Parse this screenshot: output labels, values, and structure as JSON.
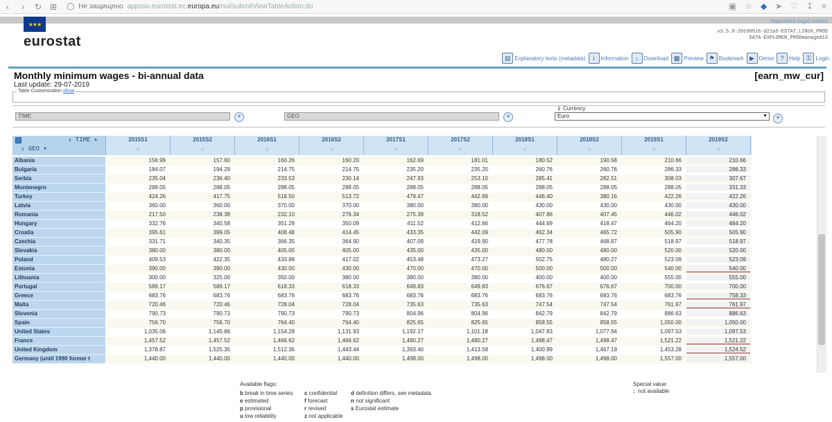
{
  "browser": {
    "security_label": "Не защищено",
    "url_prefix": "appsso.eurostat.ec.",
    "url_domain": "europa.eu",
    "url_path": "/nui/submitViewTableAction.do"
  },
  "header": {
    "legal_notice": "Important legal notice",
    "logo_text": "eurostat",
    "version_line1": "v3.5.0-20190516-d21a5-ESTAT_LINUX_PROD",
    "version_line2": "DATA-EXPLORER_PRODmanaged13",
    "toolbar": [
      {
        "label": "Explanatory texts (metadata)",
        "icon": "metadata-icon"
      },
      {
        "label": "Information",
        "icon": "info-icon"
      },
      {
        "label": "Download",
        "icon": "download-icon"
      },
      {
        "label": "Preview",
        "icon": "preview-icon"
      },
      {
        "label": "Bookmark",
        "icon": "bookmark-icon"
      },
      {
        "label": "Demo",
        "icon": "demo-icon"
      },
      {
        "label": "Help",
        "icon": "help-icon"
      },
      {
        "label": "Login",
        "icon": "login-icon"
      }
    ]
  },
  "page": {
    "title": "Monthly minimum wages - bi-annual data",
    "code": "[earn_mw_cur]",
    "last_update": "Last update: 29-07-2019"
  },
  "customization": {
    "legend": "Table Customization",
    "show_link": "show",
    "time_box": "TIME",
    "geo_box": "GEO",
    "currency_label": "Currency",
    "currency_value": "Euro"
  },
  "table": {
    "time_label": "TIME",
    "geo_label": "GEO",
    "columns": [
      "2015S1",
      "2015S2",
      "2016S1",
      "2016S2",
      "2017S1",
      "2017S2",
      "2018S1",
      "2018S2",
      "2019S1",
      "2019S2"
    ],
    "rows": [
      {
        "geo": "Albania",
        "values": [
          "156.99",
          "157.60",
          "160.26",
          "160.20",
          "162.69",
          "181.01",
          "180.52",
          "190.58",
          "210.66",
          "210.66"
        ]
      },
      {
        "geo": "Bulgaria",
        "values": [
          "184.07",
          "194.29",
          "214.75",
          "214.75",
          "235.20",
          "235.20",
          "260.76",
          "260.76",
          "286.33",
          "286.33"
        ]
      },
      {
        "geo": "Serbia",
        "values": [
          "235.04",
          "236.40",
          "233.53",
          "230.14",
          "247.93",
          "253.10",
          "285.41",
          "282.51",
          "308.03",
          "307.67"
        ]
      },
      {
        "geo": "Montenegro",
        "values": [
          "288.05",
          "288.05",
          "288.05",
          "288.05",
          "288.05",
          "288.05",
          "288.05",
          "288.05",
          "288.05",
          "331.33"
        ]
      },
      {
        "geo": "Turkey",
        "values": [
          "424.26",
          "417.75",
          "518.50",
          "513.72",
          "479.47",
          "442.89",
          "446.40",
          "380.16",
          "422.26",
          "422.26"
        ]
      },
      {
        "geo": "Latvia",
        "values": [
          "360.00",
          "360.00",
          "370.00",
          "370.00",
          "380.00",
          "380.00",
          "430.00",
          "430.00",
          "430.00",
          "430.00"
        ]
      },
      {
        "geo": "Romania",
        "values": [
          "217.50",
          "238.38",
          "232.10",
          "276.34",
          "275.39",
          "318.52",
          "407.86",
          "407.45",
          "446.02",
          "446.02"
        ]
      },
      {
        "geo": "Hungary",
        "values": [
          "332.76",
          "340.58",
          "351.29",
          "350.09",
          "411.52",
          "412.66",
          "444.69",
          "418.47",
          "464.20",
          "464.20"
        ]
      },
      {
        "geo": "Croatia",
        "values": [
          "395.61",
          "399.05",
          "408.48",
          "414.45",
          "433.35",
          "442.09",
          "462.34",
          "465.72",
          "505.90",
          "505.90"
        ]
      },
      {
        "geo": "Czechia",
        "values": [
          "331.71",
          "340.35",
          "366.35",
          "364.90",
          "407.09",
          "419.90",
          "477.78",
          "468.87",
          "518.97",
          "518.97"
        ]
      },
      {
        "geo": "Slovakia",
        "values": [
          "380.00",
          "380.00",
          "405.00",
          "405.00",
          "435.00",
          "435.00",
          "480.00",
          "480.00",
          "520.00",
          "520.00"
        ]
      },
      {
        "geo": "Poland",
        "values": [
          "409.53",
          "422.35",
          "433.88",
          "417.02",
          "453.48",
          "473.27",
          "502.75",
          "480.27",
          "523.09",
          "523.09"
        ]
      },
      {
        "geo": "Estonia",
        "values": [
          "390.00",
          "390.00",
          "430.00",
          "430.00",
          "470.00",
          "470.00",
          "500.00",
          "500.00",
          "540.00",
          "540.00"
        ]
      },
      {
        "geo": "Lithuania",
        "values": [
          "300.00",
          "325.00",
          "350.00",
          "380.00",
          "380.00",
          "380.00",
          "400.00",
          "400.00",
          "555.00",
          "555.00"
        ]
      },
      {
        "geo": "Portugal",
        "values": [
          "589.17",
          "589.17",
          "618.33",
          "618.33",
          "649.83",
          "649.83",
          "676.67",
          "676.67",
          "700.00",
          "700.00"
        ]
      },
      {
        "geo": "Greece",
        "values": [
          "683.76",
          "683.76",
          "683.76",
          "683.76",
          "683.76",
          "683.76",
          "683.76",
          "683.76",
          "683.76",
          "758.33"
        ]
      },
      {
        "geo": "Malta",
        "values": [
          "720.46",
          "720.46",
          "728.04",
          "728.04",
          "735.63",
          "735.63",
          "747.54",
          "747.54",
          "761.97",
          "761.97"
        ]
      },
      {
        "geo": "Slovenia",
        "values": [
          "790.73",
          "790.73",
          "790.73",
          "790.73",
          "804.96",
          "804.96",
          "842.79",
          "842.79",
          "886.63",
          "886.63"
        ]
      },
      {
        "geo": "Spain",
        "values": [
          "756.70",
          "756.70",
          "764.40",
          "764.40",
          "825.65",
          "825.65",
          "858.55",
          "858.55",
          "1,050.00",
          "1,050.00"
        ]
      },
      {
        "geo": "United States",
        "values": [
          "1,035.06",
          "1,145.86",
          "1,154.28",
          "1,131.93",
          "1,192.17",
          "1,101.18",
          "1,047.83",
          "1,077.94",
          "1,097.53",
          "1,097.53"
        ]
      },
      {
        "geo": "France",
        "values": [
          "1,457.52",
          "1,457.52",
          "1,466.62",
          "1,466.62",
          "1,480.27",
          "1,480.27",
          "1,498.47",
          "1,498.47",
          "1,521.22",
          "1,521.22"
        ]
      },
      {
        "geo": "United Kingdom",
        "values": [
          "1,378.87",
          "1,525.35",
          "1,512.36",
          "1,443.44",
          "1,393.40",
          "1,413.58",
          "1,400.99",
          "1,467.19",
          "1,453.28",
          "1,524.52"
        ]
      },
      {
        "geo": "Germany (until 1990 former t",
        "values": [
          "1,440.00",
          "1,440.00",
          "1,440.00",
          "1,440.00",
          "1,498.00",
          "1,498.00",
          "1,498.00",
          "1,498.00",
          "1,557.00",
          "1,557.00"
        ]
      }
    ]
  },
  "flags": {
    "title": "Available flags:",
    "col1": [
      [
        "b",
        "break in time series"
      ],
      [
        "e",
        "estimated"
      ],
      [
        "p",
        "provisional"
      ],
      [
        "u",
        "low reliability"
      ]
    ],
    "col2": [
      [
        "c",
        "confidential"
      ],
      [
        "f",
        "forecast"
      ],
      [
        "r",
        "revised"
      ],
      [
        "z",
        "not applicable"
      ]
    ],
    "col3": [
      [
        "d",
        "definition differs, see metadata"
      ],
      [
        "n",
        "not significant"
      ],
      [
        "s",
        "Eurostat estimate"
      ]
    ],
    "special_title": "Special value:",
    "special_symbol": ":",
    "special_text": "not available"
  }
}
